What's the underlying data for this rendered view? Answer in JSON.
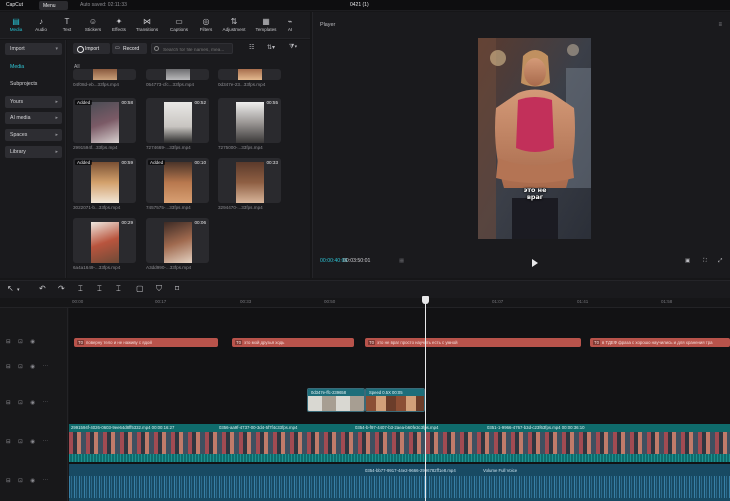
{
  "titlebar": {
    "app_name": "CapCut",
    "menu_label": "Menu",
    "autosave": "Auto saved: 02:11:33",
    "project_title": "0421 (1)"
  },
  "toolbar": {
    "tools": [
      {
        "label": "Media",
        "icon": "media-icon",
        "glyph": "▤"
      },
      {
        "label": "Audio",
        "icon": "audio-icon",
        "glyph": "♪"
      },
      {
        "label": "Text",
        "icon": "text-icon",
        "glyph": "T"
      },
      {
        "label": "Stickers",
        "icon": "sticker-icon",
        "glyph": "☺"
      },
      {
        "label": "Effects",
        "icon": "effects-icon",
        "glyph": "✦"
      },
      {
        "label": "Transitions",
        "icon": "transitions-icon",
        "glyph": "⋈"
      },
      {
        "label": "Captions",
        "icon": "captions-icon",
        "glyph": "▭"
      },
      {
        "label": "Filters",
        "icon": "filters-icon",
        "glyph": "◎"
      },
      {
        "label": "Adjustment",
        "icon": "adjustment-icon",
        "glyph": "⇅"
      },
      {
        "label": "Templates",
        "icon": "templates-icon",
        "glyph": "▦"
      },
      {
        "label": "AI",
        "icon": "ai-icon",
        "glyph": "⌁"
      }
    ]
  },
  "sidenav": {
    "import": "Import",
    "media": "Media",
    "subprojects": "Subprojects",
    "yours": "Yours",
    "ai_media": "AI media",
    "spaces": "Spaces",
    "library": "Library"
  },
  "media": {
    "import_label": "Import",
    "record_label": "Record",
    "search_placeholder": "Search for file names, mea...",
    "all_label": "All",
    "items": [
      {
        "name": "04f08d-eb...33fps.mp4",
        "badge": "",
        "duration": ""
      },
      {
        "name": "054773-cfc...33fps.mp4",
        "badge": "",
        "duration": ""
      },
      {
        "name": "0d347e-23...33fps.mp4",
        "badge": "",
        "duration": ""
      },
      {
        "name": "2991594f...33fps.mp4",
        "badge": "Added",
        "duration": "00:58"
      },
      {
        "name": "7274669-...33fps.mp4",
        "badge": "",
        "duration": "00:52"
      },
      {
        "name": "7275000-...33fps.mp4",
        "badge": "",
        "duration": "00:55"
      },
      {
        "name": "3022071-b...33fps.mp4",
        "badge": "Added",
        "duration": "00:59"
      },
      {
        "name": "7457575-...33fps.mp4",
        "badge": "Added",
        "duration": "00:10"
      },
      {
        "name": "3294470-...33fps.mp4",
        "badge": "",
        "duration": "00:33"
      },
      {
        "name": "6a4a1649-...33fps.mp4",
        "badge": "",
        "duration": "00:29"
      },
      {
        "name": "A3dd990-...33fps.mp4",
        "badge": "",
        "duration": "00:06"
      }
    ]
  },
  "player": {
    "title": "Player",
    "subtitle_text": "это не враг",
    "timecode_current": "00:00:40:06",
    "timecode_total": "00:03:50:01"
  },
  "timeline": {
    "ruler_ticks": [
      "00:00",
      "00:17",
      "00:33",
      "00:50",
      "01:07",
      "01:41",
      "01:58"
    ],
    "subtitle_clips": [
      {
        "tag": "T0",
        "text": "поверну тело и не наживу с ядой"
      },
      {
        "tag": "T0",
        "text": "это мой друзья ходь"
      },
      {
        "tag": "T0",
        "text": "это не враг просто научить есть с умной"
      },
      {
        "tag": "T0",
        "text": "в ТДЕФ фраза с хорошо научились и для хранения тра"
      }
    ],
    "overlay_clips": [
      {
        "label": "0d347e-ffc-239658"
      },
      {
        "label": "Speed 0.5X 00:05"
      }
    ],
    "main_clip_labels": [
      "2991594f-4026-0603-9ee64d8ff5332.mp4  00:00:16:27",
      "0356-aa9f-4737-00-3d4-5f7f4c33fps.mp4",
      "0354-b-f97-4407-b3-2aea-b60fe3c3fps.mp4",
      "0351-1-9966-4767-b3d-c23f63fps.mp4  00:00:36:10"
    ],
    "audio_label": "0354-bb77-9917-44e2-9666-2996782ff1e8.mp4",
    "audio_volume_label": "Volume Full Voice"
  }
}
